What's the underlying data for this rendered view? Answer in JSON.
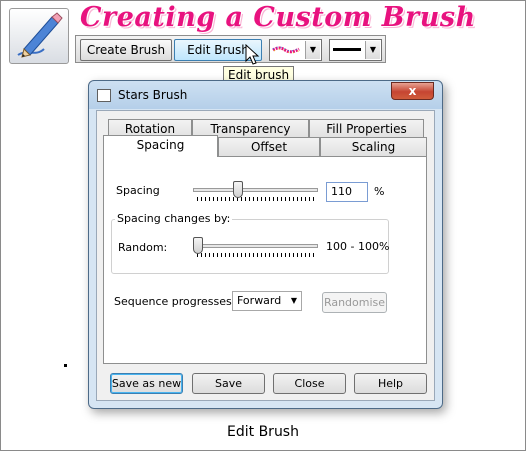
{
  "header": {
    "title": "Creating a Custom Brush",
    "app_icon": "brush-pencil-icon"
  },
  "toolbar": {
    "create_label": "Create Brush",
    "edit_label": "Edit Brush",
    "tooltip": "Edit brush",
    "stroke_preview_icon": "brush-stroke-preview-icon",
    "line_preview_icon": "line-weight-preview-icon"
  },
  "dialog": {
    "title": "Stars Brush",
    "close_glyph": "x",
    "tabs_back": [
      "Rotation",
      "Transparency",
      "Fill Properties"
    ],
    "tabs_front": [
      "Spacing",
      "Offset",
      "Scaling"
    ],
    "active_tab": "Spacing",
    "spacing": {
      "label": "Spacing",
      "value": "110",
      "unit": "%",
      "slider_fraction": 0.35
    },
    "spacing_changes": {
      "group_label": "Spacing changes by:",
      "random_label": "Random:",
      "random_fraction": 0.0,
      "range_text": "100 - 100%"
    },
    "sequence": {
      "label": "Sequence progresses:",
      "selected": "Forward",
      "randomise_label": "Randomise"
    },
    "buttons": {
      "save_as_new": "Save as new",
      "save": "Save",
      "close": "Close",
      "help": "Help"
    }
  },
  "caption": "Edit Brush",
  "colors": {
    "title_pink": "#e8127f",
    "dialog_frame": "#b5cfe9",
    "close_red": "#c64532"
  }
}
